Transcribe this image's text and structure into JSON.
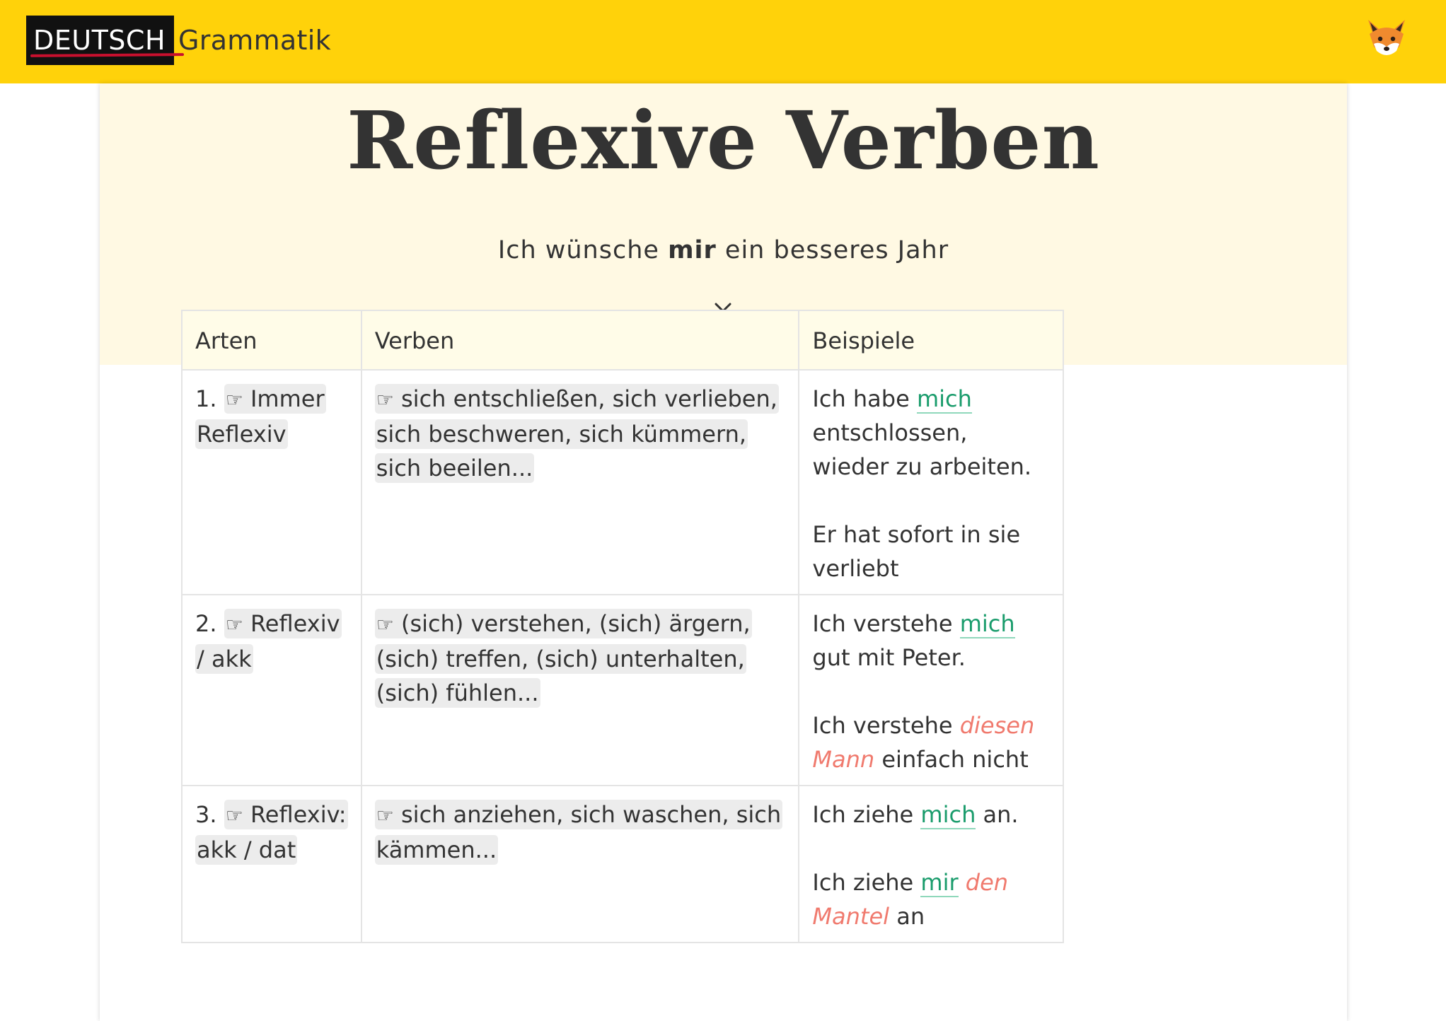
{
  "header": {
    "logo_badge": "DEUTSCH",
    "logo_text": "Grammatik",
    "mascot_icon": "fox-icon"
  },
  "hero": {
    "title": "Reflexive Verben",
    "subtitle_before": "Ich wünsche ",
    "subtitle_bold": "mir",
    "subtitle_after": " ein besseres Jahr",
    "scroll_icon": "chevron-down-icon"
  },
  "table": {
    "headers": [
      "Arten",
      "Verben",
      "Beispiele"
    ],
    "rows": [
      {
        "num": "1.",
        "hand": "☞",
        "type": " Immer Reflexiv",
        "verbs": " sich entschließen, sich verlieben, sich beschweren, sich kümmern, sich beeilen...",
        "examples": [
          {
            "pre": "Ich habe ",
            "green": "mich",
            "post": " entschlossen, wieder zu arbeiten."
          },
          {
            "pre": "Er hat sofort in sie verliebt"
          }
        ]
      },
      {
        "num": "2.",
        "hand": "☞",
        "type": " Reflexiv / akk",
        "verbs": " (sich) verstehen, (sich) ärgern, (sich) treffen, (sich) unterhalten, (sich) fühlen...",
        "examples": [
          {
            "pre": "Ich verstehe ",
            "green": "mich",
            "post": " gut mit Peter."
          },
          {
            "pre": "Ich verstehe ",
            "red": "diesen Mann",
            "post": " einfach nicht"
          }
        ]
      },
      {
        "num": "3.",
        "hand": "☞",
        "type": " Reflexiv: akk / dat",
        "verbs": " sich anziehen, sich waschen, sich kämmen...",
        "examples": [
          {
            "pre": "Ich ziehe ",
            "green": "mich",
            "post": " an."
          },
          {
            "pre": "Ich ziehe ",
            "green": "mir",
            "mid": " ",
            "red": "den Mantel",
            "post": " an"
          }
        ]
      }
    ]
  },
  "colors": {
    "header_bg": "#FFD20A",
    "hero_bg": "#FFF9E3",
    "reflexive_green": "#1a9c6c",
    "object_red": "#f07a6e"
  }
}
